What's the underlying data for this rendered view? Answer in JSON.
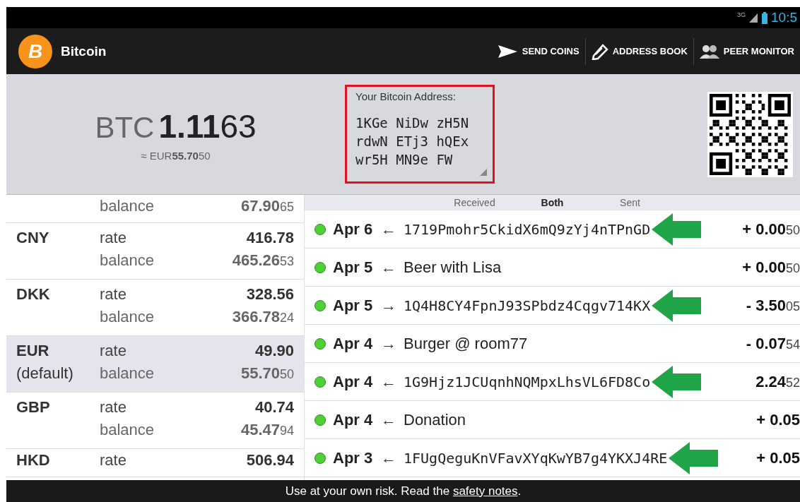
{
  "status_bar": {
    "network": "3G",
    "time": "10:5"
  },
  "action_bar": {
    "logo_symbol": "B",
    "title": "Bitcoin",
    "actions": [
      {
        "kind": "send",
        "label": "SEND COINS"
      },
      {
        "kind": "book",
        "label": "ADDRESS BOOK"
      },
      {
        "kind": "peers",
        "label": "PEER MONITOR"
      }
    ]
  },
  "balance": {
    "currency": "BTC",
    "amount": "1.11",
    "amount_tail": "63",
    "local_prefix": "≈ EUR",
    "local_amount": "55.70",
    "local_tail": "50"
  },
  "address": {
    "label": "Your Bitcoin Address:",
    "lines": [
      "1KGe NiDw zH5N",
      "rdwN ETj3 hQEx",
      "wr5H MN9e FW"
    ]
  },
  "exchange_rates": [
    {
      "balance_label": "balance",
      "balance": "67.90",
      "balance_tail": "65",
      "selected": false
    },
    {
      "code": "CNY",
      "rate_label": "rate",
      "rate": "416.78",
      "balance_label": "balance",
      "balance": "465.26",
      "balance_tail": "53",
      "selected": false
    },
    {
      "code": "DKK",
      "rate_label": "rate",
      "rate": "328.56",
      "balance_label": "balance",
      "balance": "366.78",
      "balance_tail": "24",
      "selected": false
    },
    {
      "code": "EUR",
      "note": "(default)",
      "rate_label": "rate",
      "rate": "49.90",
      "balance_label": "balance",
      "balance": "55.70",
      "balance_tail": "50",
      "selected": true
    },
    {
      "code": "GBP",
      "rate_label": "rate",
      "rate": "40.74",
      "balance_label": "balance",
      "balance": "45.47",
      "balance_tail": "94",
      "selected": false
    },
    {
      "code": "HKD",
      "rate_label": "rate",
      "rate": "506.94",
      "selected": false
    }
  ],
  "filters": [
    {
      "label": "Received",
      "selected": false
    },
    {
      "label": "Both",
      "selected": true
    },
    {
      "label": "Sent",
      "selected": false
    }
  ],
  "transactions": [
    {
      "date": "Apr 6",
      "direction": "←",
      "kind": "address",
      "label": "1719Pmohr5CkidX6mQ9zYj4nTPnGD",
      "amount": "+ 0.00",
      "amount_tail": "50",
      "marked": true
    },
    {
      "date": "Apr 5",
      "direction": "←",
      "kind": "label",
      "label": "Beer with Lisa",
      "amount": "+ 0.00",
      "amount_tail": "50",
      "marked": false
    },
    {
      "date": "Apr 5",
      "direction": "→",
      "kind": "address",
      "label": "1Q4H8CY4FpnJ93SPbdz4Cqgv714KX",
      "amount": "- 3.50",
      "amount_tail": "05",
      "marked": true
    },
    {
      "date": "Apr 4",
      "direction": "→",
      "kind": "label",
      "label": "Burger @ room77",
      "amount": "- 0.07",
      "amount_tail": "54",
      "marked": false
    },
    {
      "date": "Apr 4",
      "direction": "←",
      "kind": "address",
      "label": "1G9Hjz1JCUqnhNQMpxLhsVL6FD8Co",
      "amount": "2.24",
      "amount_tail": "52",
      "marked": true
    },
    {
      "date": "Apr 4",
      "direction": "←",
      "kind": "label",
      "label": "Donation",
      "amount": "+ 0.05",
      "marked": false
    },
    {
      "date": "Apr 3",
      "direction": "←",
      "kind": "address",
      "label": "1FUgQeguKnVFavXYqKwYB7g4YKXJ4RE",
      "amount": "+ 0.05",
      "marked": true
    }
  ],
  "footer": {
    "text": "Use at your own risk. Read the ",
    "link": "safety notes",
    "after": "."
  }
}
